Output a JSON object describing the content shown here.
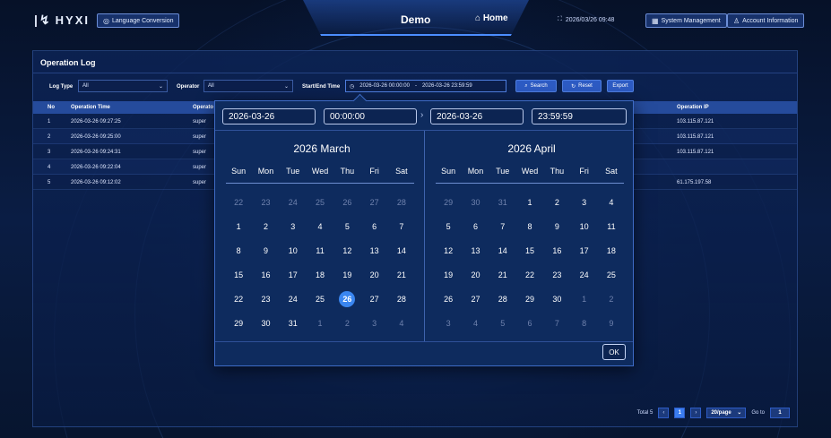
{
  "header": {
    "logo_text": "HYXI",
    "language_btn": "Language Conversion",
    "title": "Demo",
    "home_label": "Home",
    "datetime": "2026/03/26 09:48",
    "system_btn": "System Management",
    "account_btn": "Account Information"
  },
  "panel": {
    "title": "Operation Log",
    "filters": {
      "log_type_label": "Log Type",
      "log_type_value": "All",
      "operator_label": "Operator",
      "operator_value": "All",
      "time_label": "Start/End Time",
      "start_value": "2026-03-26 00:00:00",
      "range_sep": "-",
      "end_value": "2026-03-26 23:59:59",
      "search_label": "Search",
      "reset_label": "Reset",
      "export_label": "Export"
    },
    "table": {
      "headers": {
        "no": "No",
        "time": "Operation Time",
        "operator": "Operato",
        "ip": "Operation IP"
      },
      "rows": [
        {
          "no": "1",
          "time": "2026-03-26 09:27:25",
          "operator": "super",
          "ip": "103.115.87.121"
        },
        {
          "no": "2",
          "time": "2026-03-26 09:25:00",
          "operator": "super",
          "ip": "103.115.87.121"
        },
        {
          "no": "3",
          "time": "2026-03-26 09:24:31",
          "operator": "super",
          "ip": "103.115.87.121"
        },
        {
          "no": "4",
          "time": "2026-03-26 09:22:04",
          "operator": "super",
          "ip": ""
        },
        {
          "no": "5",
          "time": "2026-03-26 09:12:02",
          "operator": "super",
          "ip": "61.175.197.58"
        }
      ]
    },
    "pager": {
      "total": "Total 5",
      "current_page": "1",
      "page_size": "20/page",
      "goto_label": "Go to",
      "goto_value": "1"
    }
  },
  "picker": {
    "start_date": "2026-03-26",
    "start_time": "00:00:00",
    "end_date": "2026-03-26",
    "end_time": "23:59:59",
    "left_month": "2026 March",
    "right_month": "2026 April",
    "weekdays": [
      "Sun",
      "Mon",
      "Tue",
      "Wed",
      "Thu",
      "Fri",
      "Sat"
    ],
    "left_days": [
      [
        "22",
        "prev"
      ],
      [
        "23",
        "prev"
      ],
      [
        "24",
        "prev"
      ],
      [
        "25",
        "prev"
      ],
      [
        "26",
        "prev"
      ],
      [
        "27",
        "prev"
      ],
      [
        "28",
        "prev"
      ],
      [
        "1",
        "cur"
      ],
      [
        "2",
        "cur"
      ],
      [
        "3",
        "cur"
      ],
      [
        "4",
        "cur"
      ],
      [
        "5",
        "cur"
      ],
      [
        "6",
        "cur"
      ],
      [
        "7",
        "cur"
      ],
      [
        "8",
        "cur"
      ],
      [
        "9",
        "cur"
      ],
      [
        "10",
        "cur"
      ],
      [
        "11",
        "cur"
      ],
      [
        "12",
        "cur"
      ],
      [
        "13",
        "cur"
      ],
      [
        "14",
        "cur"
      ],
      [
        "15",
        "cur"
      ],
      [
        "16",
        "cur"
      ],
      [
        "17",
        "cur"
      ],
      [
        "18",
        "cur"
      ],
      [
        "19",
        "cur"
      ],
      [
        "20",
        "cur"
      ],
      [
        "21",
        "cur"
      ],
      [
        "22",
        "cur"
      ],
      [
        "23",
        "cur"
      ],
      [
        "24",
        "cur"
      ],
      [
        "25",
        "cur"
      ],
      [
        "26",
        "sel"
      ],
      [
        "27",
        "cur"
      ],
      [
        "28",
        "cur"
      ],
      [
        "29",
        "cur"
      ],
      [
        "30",
        "cur"
      ],
      [
        "31",
        "cur"
      ],
      [
        "1",
        "next"
      ],
      [
        "2",
        "next"
      ],
      [
        "3",
        "next"
      ],
      [
        "4",
        "next"
      ]
    ],
    "right_days": [
      [
        "29",
        "prev"
      ],
      [
        "30",
        "prev"
      ],
      [
        "31",
        "prev"
      ],
      [
        "1",
        "cur"
      ],
      [
        "2",
        "cur"
      ],
      [
        "3",
        "cur"
      ],
      [
        "4",
        "cur"
      ],
      [
        "5",
        "cur"
      ],
      [
        "6",
        "cur"
      ],
      [
        "7",
        "cur"
      ],
      [
        "8",
        "cur"
      ],
      [
        "9",
        "cur"
      ],
      [
        "10",
        "cur"
      ],
      [
        "11",
        "cur"
      ],
      [
        "12",
        "cur"
      ],
      [
        "13",
        "cur"
      ],
      [
        "14",
        "cur"
      ],
      [
        "15",
        "cur"
      ],
      [
        "16",
        "cur"
      ],
      [
        "17",
        "cur"
      ],
      [
        "18",
        "cur"
      ],
      [
        "19",
        "cur"
      ],
      [
        "20",
        "cur"
      ],
      [
        "21",
        "cur"
      ],
      [
        "22",
        "cur"
      ],
      [
        "23",
        "cur"
      ],
      [
        "24",
        "cur"
      ],
      [
        "25",
        "cur"
      ],
      [
        "26",
        "cur"
      ],
      [
        "27",
        "cur"
      ],
      [
        "28",
        "cur"
      ],
      [
        "29",
        "cur"
      ],
      [
        "30",
        "cur"
      ],
      [
        "1",
        "next"
      ],
      [
        "2",
        "next"
      ],
      [
        "3",
        "next"
      ],
      [
        "4",
        "next"
      ],
      [
        "5",
        "next"
      ],
      [
        "6",
        "next"
      ],
      [
        "7",
        "next"
      ],
      [
        "8",
        "next"
      ],
      [
        "9",
        "next"
      ]
    ],
    "ok_label": "OK"
  }
}
